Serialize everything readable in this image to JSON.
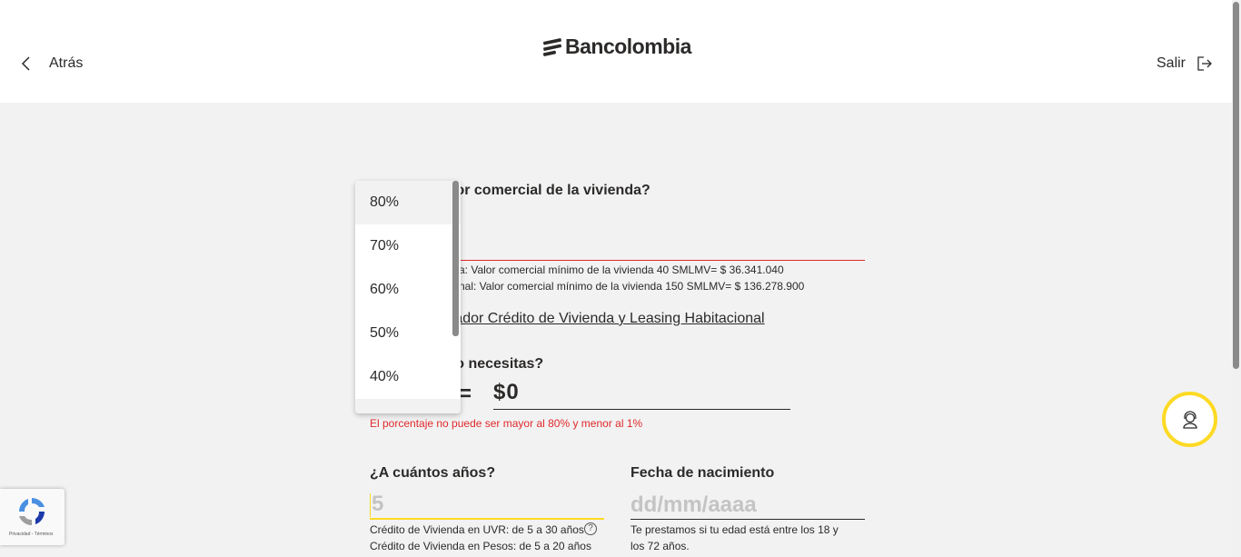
{
  "header": {
    "back_label": "Atrás",
    "brand": "Bancolombia",
    "exit_label": "Salir"
  },
  "property_value": {
    "question_partial": "lor comercial de la vivienda?",
    "hint_1_partial": "a: Valor comercial mínimo de la vivienda 40 SMLMV= $ 36.341.040",
    "hint_2_partial": "nal: Valor comercial mínimo de la vivienda 150 SMLMV= $ 136.278.900"
  },
  "simulator_link_partial": "rador Crédito de Vivienda y Leasing Habitacional",
  "loan": {
    "question_partial": "ro necesitas?",
    "equals": "=",
    "amount": "$0",
    "error": "El porcentaje no puede ser mayor al 80% y menor al 1%"
  },
  "years": {
    "question": "¿A cuántos años?",
    "placeholder": "5",
    "hint_uvr": "Crédito de Vivienda en UVR: de 5 a 30 años",
    "hint_pesos": "Crédito de Vivienda en Pesos: de 5 a 20 años",
    "help_glyph": "?"
  },
  "birth_date": {
    "label": "Fecha de nacimiento",
    "placeholder": "dd/mm/aaaa",
    "hint_line1": "Te prestamos si tu edad está entre los 18 y",
    "hint_line2": "los 72 años."
  },
  "percentage_dropdown": {
    "options": [
      "80%",
      "70%",
      "60%",
      "50%",
      "40%"
    ],
    "highlighted": "80%"
  },
  "recaptcha": {
    "footer": "Privacidad - Términos"
  },
  "icons": [
    "chevron-left-icon",
    "bancolombia-logo-icon",
    "logout-icon",
    "support-agent-icon",
    "recaptcha-icon"
  ],
  "colors": {
    "accent": "#fdda24",
    "error": "#e0292c",
    "text": "#2c2a29",
    "background": "#f2f2f2"
  }
}
